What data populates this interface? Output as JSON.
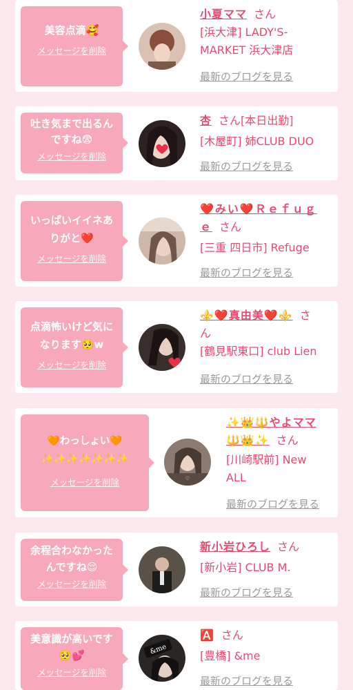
{
  "cards": [
    {
      "message": "美容点滴🥰",
      "delete_label": "メッセージを削除",
      "name": "小夏ママ",
      "honorific": "さん",
      "shop": "[浜大津] LADY'S-\nMARKET 浜大津店",
      "blog_label": "最新のブログを見る",
      "avatar_color": "#b5866f"
    },
    {
      "message": "吐き気まで出るん\nですね😨",
      "delete_label": "メッセージを削除",
      "name": "杏",
      "honorific": "さん[本日出勤]",
      "shop": "[木屋町] 姉CLUB DUO",
      "blog_label": "最新のブログを見る",
      "avatar_color": "#3a2a28"
    },
    {
      "message": "いっぱいイイネあ\nりがと❤️",
      "delete_label": "メッセージを削除",
      "name": "❤️みい❤️Ｒｅｆｕｇ\nｅ",
      "honorific": "さん",
      "shop": "[三重 四日市] Refuge",
      "blog_label": "最新のブログを見る",
      "avatar_color": "#c9b4a6"
    },
    {
      "message": "点滴怖いけど気に\nなります🥺w",
      "delete_label": "メッセージを削除",
      "name": "⚜️❤️真由美❤️⚜️",
      "honorific": "さ\nん",
      "shop": "[鶴見駅東口] club Lien",
      "blog_label": "最新のブログを見る",
      "avatar_color": "#4a3c3a"
    },
    {
      "message": "🧡わっしょい🧡\n✨✨✨✨✨✨✨",
      "delete_label": "メッセージを削除",
      "name": "✨👑🔱やよママ\n🔱👑✨",
      "honorific": "さん",
      "shop": "[川崎駅前] New\nALL",
      "blog_label": "最新のブログを見る",
      "avatar_color": "#6b5a52"
    },
    {
      "message": "余程合わなかった\nんですね😌",
      "delete_label": "メッセージを削除",
      "name": "新小岩ひろし",
      "honorific": "さん",
      "shop": "[新小岩] CLUB M.",
      "blog_label": "最新のブログを見る",
      "avatar_color": "#3d3a36"
    },
    {
      "message": "美意識が高いです\n🥺💕",
      "delete_label": "メッセージを削除",
      "name": "🅰️",
      "honorific": "さん",
      "shop": "[豊橋] &me",
      "blog_label": "最新のブログを見る",
      "avatar_color": "#2a2624"
    }
  ],
  "avatar_texts": {
    "card7": "&me"
  }
}
